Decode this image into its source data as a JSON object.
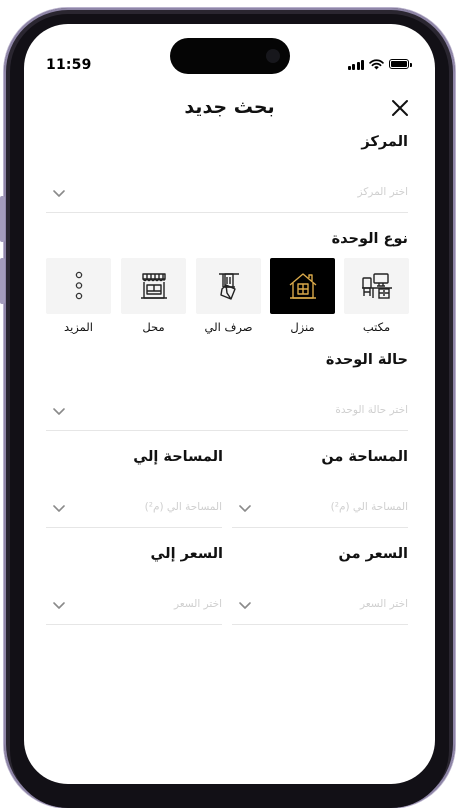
{
  "status_bar": {
    "time": "11:59",
    "battery_level": 1.0
  },
  "header": {
    "title": "بحث جديد"
  },
  "center": {
    "label": "المركز",
    "placeholder": "اختر المركز"
  },
  "unit_type": {
    "label": "نوع الوحدة",
    "selected": "منزل",
    "options": [
      {
        "label": "مكتب",
        "icon": "office-desk-icon"
      },
      {
        "label": "منزل",
        "icon": "house-icon"
      },
      {
        "label": "صرف الي",
        "icon": "atm-card-icon"
      },
      {
        "label": "محل",
        "icon": "storefront-icon"
      },
      {
        "label": "المزيد",
        "icon": "more-dots-icon"
      }
    ]
  },
  "unit_status": {
    "label": "حالة الوحدة",
    "placeholder": "اختر حالة الوحدة"
  },
  "area_from": {
    "label": "المساحة من",
    "placeholder": "المساحة الي (م²)"
  },
  "area_to": {
    "label": "المساحة إلي",
    "placeholder": "المساحة الي (م²)"
  },
  "price_from": {
    "label": "السعر من",
    "placeholder": "اختر السعر"
  },
  "price_to": {
    "label": "السعر إلي",
    "placeholder": "اختر السعر"
  },
  "colors": {
    "selected_bg": "#000000",
    "selected_icon": "#d9a94a",
    "tile_bg": "#f4f4f4",
    "placeholder": "#cfcfcf"
  }
}
